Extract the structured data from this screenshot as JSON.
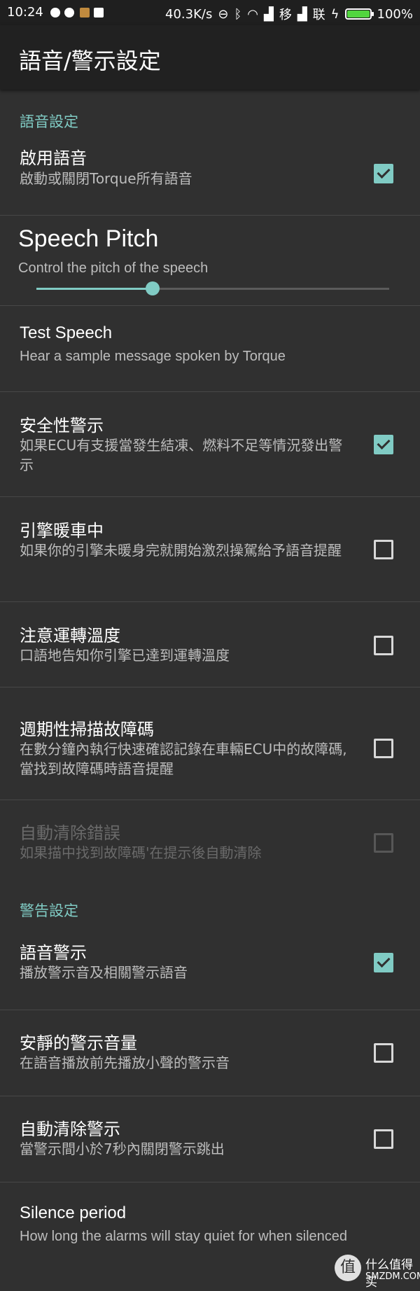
{
  "status_bar": {
    "time": "10:24",
    "network_speed": "40.3K/s",
    "carrier_1": "移",
    "carrier_2": "联",
    "battery": "100%",
    "battery_level": 1.0,
    "battery_color": "#52d63f"
  },
  "toolbar": {
    "title": "語音/警示設定"
  },
  "sections": {
    "voice": "語音設定",
    "alarm": "警告設定"
  },
  "prefs": {
    "enable_voice": {
      "title": "啟用語音",
      "summary": "啟動或關閉Torque所有語音",
      "checked": true
    },
    "speech_pitch": {
      "title": "Speech Pitch",
      "summary": "Control the pitch of the speech",
      "value": 0.33
    },
    "test_speech": {
      "title": "Test Speech",
      "summary": "Hear a sample message spoken by Torque"
    },
    "safety_alarm": {
      "title": "安全性警示",
      "summary": "如果ECU有支援當發生結凍、燃料不足等情況發出警示",
      "checked": true
    },
    "engine_warmup": {
      "title": "引擎暖車中",
      "summary": "如果你的引擎未暖身完就開始激烈操駕給予語音提醒",
      "checked": false
    },
    "operating_temp": {
      "title": "注意運轉溫度",
      "summary": "口語地告知你引擎已達到運轉溫度",
      "checked": false
    },
    "periodic_scan": {
      "title": "週期性掃描故障碼",
      "summary": "在數分鐘內執行快速確認記錄在車輛ECU中的故障碼, 當找到故障碼時語音提醒",
      "checked": false
    },
    "auto_clear_errors": {
      "title": "自動清除錯誤",
      "summary": "如果描中找到故障碼'在提示後自動清除",
      "checked": false,
      "enabled": false
    },
    "voice_alarm": {
      "title": "語音警示",
      "summary": "播放警示音及相關警示語音",
      "checked": true
    },
    "quiet_alarm": {
      "title": "安靜的警示音量",
      "summary": "在語音播放前先播放小聲的警示音",
      "checked": false
    },
    "auto_clear_alarm": {
      "title": "自動清除警示",
      "summary": "當警示間小於7秒內關閉警示跳出",
      "checked": false
    },
    "silence_period": {
      "title": "Silence period",
      "summary": "How long the alarms will stay quiet for when silenced"
    }
  },
  "watermark": {
    "icon": "值",
    "cn": "什么值得买",
    "en": "SMZDM.COM"
  },
  "colors": {
    "accent": "#80cbc4",
    "background": "#303030",
    "toolbar": "#212121"
  }
}
